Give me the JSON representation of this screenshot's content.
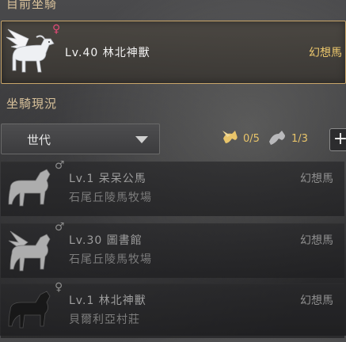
{
  "current_section": {
    "title": "目前坐騎"
  },
  "current_mount": {
    "gender": "♀",
    "name": "Lv.40 林北神獸",
    "type": "幻想馬"
  },
  "status_section": {
    "title": "坐騎現況"
  },
  "filters": {
    "generation_select": "世代",
    "winged_count": "0/5",
    "ground_count": "1/3",
    "add_label": "+"
  },
  "mounts": [
    {
      "gender": "♂",
      "name": "Lv.1 呆呆公馬",
      "type": "幻想馬",
      "location": "石尾丘陵馬牧場"
    },
    {
      "gender": "♂",
      "name": "Lv.30 圖書館",
      "type": "幻想馬",
      "location": "石尾丘陵馬牧場"
    },
    {
      "gender": "♀",
      "name": "Lv.1 林北神獸",
      "type": "幻想馬",
      "location": "貝爾利亞村莊"
    }
  ],
  "colors": {
    "accent_gold": "#ecc76c",
    "female_pink": "#e24a76",
    "card_border": "#c9a66a"
  },
  "icons": [
    "winged-horse-icon",
    "ground-horse-icon",
    "dropdown-arrow-icon",
    "plus-icon"
  ]
}
